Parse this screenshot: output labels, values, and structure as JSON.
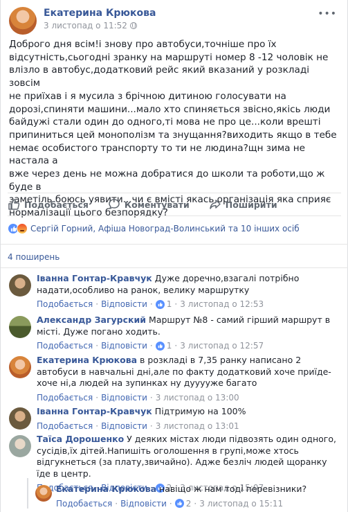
{
  "post": {
    "author": "Екатерина Крюкова",
    "timestamp": "3 листопад о 11:52",
    "more_icon": "more-horizontal-icon",
    "text": "Доброго дня всім!і знову про автобуси,точніше про їх\nвідсутність,сьогодні зранку на маршруті номер 8 -12 чоловік не\nвлізло в автобус,додатковий рейс який вказаний у розкладі зовсім\nне приїхав і я мусила з брічною дитиною голосувати на\nдорозі,спиняти машини...мало хто спиняється звісно,якісь люди\nбайдужі стали один до одного,ті мова не про це...коли врешті\nприпиниться цей монополізм та знущання?виходить якщо в тебе\nнемає особистого транспорту то ти не людина?щн зима не настала а\nвже через день не можна добратися до школи та роботи,що ж буде в\nзаметіль боюсь уявити...чи є вмісті якась організація яка сприяє\nнормалізації цього безпорядку?"
  },
  "actions": {
    "like": "Подобається",
    "comment": "Коментувати",
    "share": "Поширити"
  },
  "reactions_summary": "Сергій Горний, Афіша Новоград-Волинський та 10 інших осіб",
  "shares_count": "4 поширень",
  "comments": [
    {
      "name": "Іванна Гонтар-Кравчук",
      "text": "Дуже доречно,взагалі потрібно надати,особливо на ранок, велику маршрутку",
      "like": "Подобається",
      "reply": "Відповісти",
      "likes": "1",
      "time": "3 листопад о 12:53",
      "avatar_color": "#7a6a4f"
    },
    {
      "name": "Александр Загурский",
      "text": "Маршрут №8 - самий гірший маршрут в місті. Дуже погано ходить.",
      "like": "Подобається",
      "reply": "Відповісти",
      "likes": "1",
      "time": "3 листопад о 12:57",
      "avatar_color": "#5b6f3a"
    },
    {
      "name": "Екатерина Крюкова",
      "text": "в розкладі в 7,35 ранку написано 2 автобуси в навчальні дні,але по факту додатковий хоче приїде-хоче ні,а людей на зупинках ну дууууже багато",
      "like": "Подобається",
      "reply": "Відповісти",
      "likes": "",
      "time": "3 листопад о 13:00",
      "avatar_color": "#c8672c"
    },
    {
      "name": "Іванна Гонтар-Кравчук",
      "text": "Підтримую на 100%",
      "like": "Подобається",
      "reply": "Відповісти",
      "likes": "",
      "time": "3 листопад о 13:01",
      "avatar_color": "#7a6a4f"
    },
    {
      "name": "Таїса Дорошенко",
      "text": "У деяких містах люди підвозять один одного, сусідів,їх дітей.Напишіть оголошення в групі,може хтось відгукнеться (за плату,звичайно). Адже безліч людей щоранку їде в центр.",
      "like": "Подобається",
      "reply": "Відповісти",
      "likes": "2",
      "time": "3 листопад о 15:07",
      "avatar_color": "#9aa7a0"
    }
  ],
  "reply": {
    "name": "Екатерина Крюкова",
    "text": "навіщо ж нам тоді перевізники?",
    "like": "Подобається",
    "reply": "Відповісти",
    "likes": "2",
    "time": "3 листопад о 15:11",
    "avatar_color": "#c8672c"
  },
  "colors": {
    "link": "#385898",
    "meta": "#90949c",
    "like_blue": "#5890ff"
  }
}
